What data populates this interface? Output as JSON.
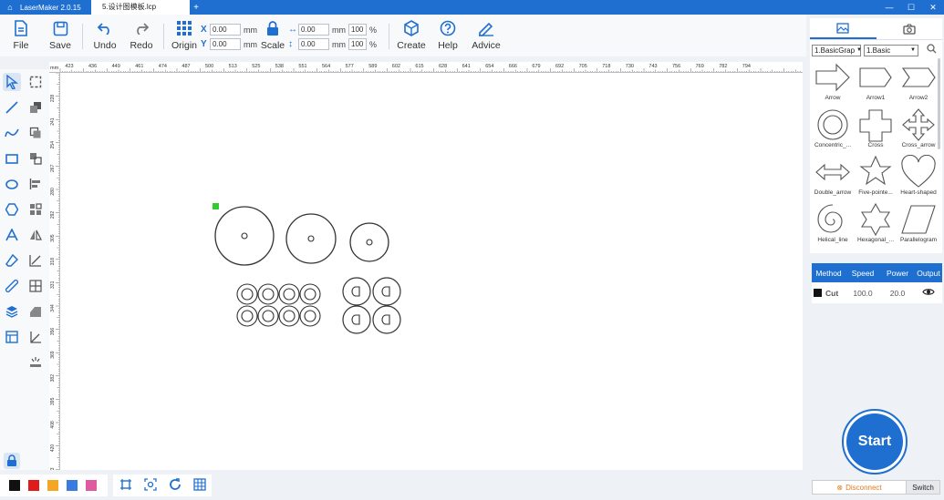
{
  "titlebar": {
    "app_name": "LaserMaker 2.0.15",
    "file_tab": "5.设计图模板.lcp",
    "new_tab": "+",
    "minimize": "—",
    "maximize": "☐",
    "close": "✕"
  },
  "toolbar": {
    "file_label": "File",
    "save_label": "Save",
    "undo_label": "Undo",
    "redo_label": "Redo",
    "origin_label": "Origin",
    "scale_label": "Scale",
    "create_label": "Create",
    "help_label": "Help",
    "advice_label": "Advice",
    "x_label": "X",
    "y_label": "Y",
    "x_value": "0.00",
    "y_value": "0.00",
    "width_value": "0.00",
    "height_value": "0.00",
    "width_pct": "100",
    "height_pct": "100",
    "unit_mm": "mm",
    "unit_pct": "%"
  },
  "ruler": {
    "horizontal": [
      "423",
      "436",
      "449",
      "461",
      "474",
      "487",
      "500",
      "513",
      "525",
      "538",
      "551",
      "564",
      "577",
      "589",
      "602",
      "615",
      "628",
      "641",
      "654",
      "666",
      "679",
      "692",
      "705",
      "718",
      "730",
      "743",
      "756",
      "769",
      "782",
      "794"
    ],
    "vertical": [
      "228",
      "241",
      "254",
      "267",
      "280",
      "292",
      "305",
      "318",
      "331",
      "344",
      "356",
      "369",
      "382",
      "395",
      "408",
      "420",
      "433"
    ],
    "unit": "mm"
  },
  "palette": {
    "colors": [
      "#111111",
      "#e01b1b",
      "#f5a623",
      "#3a7be0",
      "#e05aa0"
    ]
  },
  "library": {
    "category_select": "1.BasicGrap",
    "sub_select": "1.Basic",
    "shapes": [
      {
        "name": "Arrow",
        "icon": "arrow-shape"
      },
      {
        "name": "Arrow1",
        "icon": "arrow1-shape"
      },
      {
        "name": "Arrow2",
        "icon": "arrow2-shape"
      },
      {
        "name": "Concentric_...",
        "icon": "concentric-shape"
      },
      {
        "name": "Cross",
        "icon": "cross-shape"
      },
      {
        "name": "Cross_arrow",
        "icon": "cross-arrow-shape"
      },
      {
        "name": "Double_arrow",
        "icon": "double-arrow-shape"
      },
      {
        "name": "Five-pointe...",
        "icon": "star-shape"
      },
      {
        "name": "Heart-shaped",
        "icon": "heart-shape"
      },
      {
        "name": "Helical_line",
        "icon": "spiral-shape"
      },
      {
        "name": "Hexagonal_...",
        "icon": "hexagram-shape"
      },
      {
        "name": "Parallelogram",
        "icon": "parallelogram-shape"
      }
    ]
  },
  "layers": {
    "headers": [
      "Method",
      "Speed",
      "Power",
      "Output"
    ],
    "rows": [
      {
        "color": "#111111",
        "method": "Cut",
        "speed": "100.0",
        "power": "20.0"
      }
    ]
  },
  "start_label": "Start",
  "disconnect_label": "Disconnect",
  "switch_label": "Switch"
}
